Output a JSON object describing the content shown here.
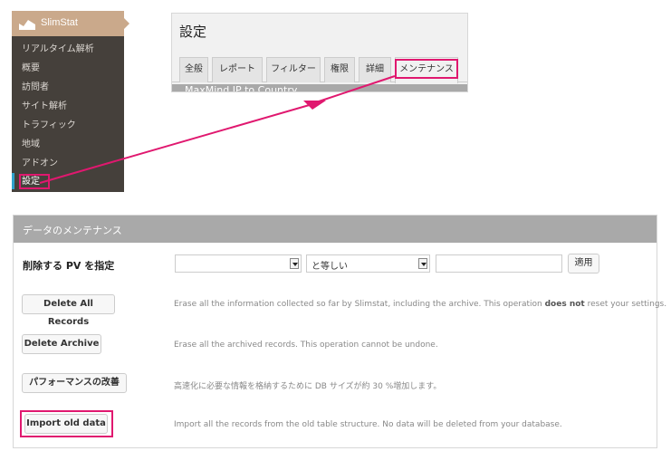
{
  "sidebar": {
    "title": "SlimStat",
    "items": [
      {
        "label": "リアルタイム解析"
      },
      {
        "label": "概要"
      },
      {
        "label": "訪問者"
      },
      {
        "label": "サイト解析"
      },
      {
        "label": "トラフィック"
      },
      {
        "label": "地域"
      },
      {
        "label": "アドオン"
      },
      {
        "label": "設定"
      }
    ]
  },
  "settings": {
    "title": "設定",
    "tabs": [
      "全般",
      "レポート",
      "フィルター",
      "権限",
      "詳細",
      "メンテナンス"
    ],
    "active_tab": "メンテナンス",
    "section_label": "MaxMind IP to Country"
  },
  "maintenance": {
    "header": "データのメンテナンス",
    "delete_pv_label": "削除する PV を指定",
    "operator_value": "と等しい",
    "apply_label": "適用",
    "actions": [
      {
        "button": "Delete All Records",
        "desc_pre": "Erase all the information collected so far by Slimstat, including the archive. This operation ",
        "desc_bold": "does not",
        "desc_post": " reset your settings."
      },
      {
        "button": "Delete Archive",
        "desc_pre": "Erase all the archived records. This operation cannot be undone.",
        "desc_bold": "",
        "desc_post": ""
      },
      {
        "button": "パフォーマンスの改善",
        "desc_pre": "高速化に必要な情報を格納するために DB サイズが約 30 %増加します。",
        "desc_bold": "",
        "desc_post": ""
      },
      {
        "button": "Import old data",
        "desc_pre": "Import all the records from the old table structure. No data will be deleted from your database.",
        "desc_bold": "",
        "desc_post": ""
      }
    ]
  },
  "colors": {
    "highlight": "#e0186f",
    "sidebar_bg": "#45403b",
    "sidebar_head": "#caa98b",
    "panel_header": "#a9a9a9"
  }
}
